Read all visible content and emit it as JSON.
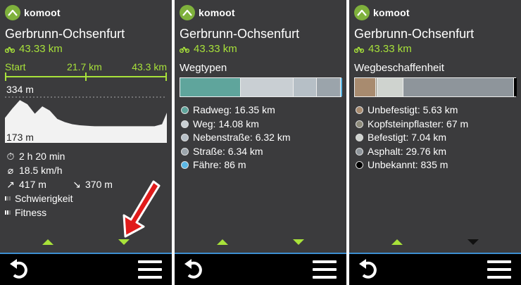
{
  "brand": "komoot",
  "route": {
    "title": "Gerbrunn-Ochsenfurt",
    "distance": "43.33 km"
  },
  "colors": {
    "accent": "#a8e23a",
    "screen_bg": "#3b3b3d",
    "bottom_bar": "#000000",
    "separator": "#3d8fd1",
    "annotation_arrow": "#e01b1b"
  },
  "screen1": {
    "scale": {
      "start": "Start",
      "mid": "21.7 km",
      "end": "43.3 km"
    },
    "elevation": {
      "max_label": "334 m",
      "min_label": "173 m"
    },
    "chart_data": {
      "type": "area",
      "x": [
        0,
        2,
        4,
        6,
        8,
        10,
        12,
        14,
        16,
        18,
        20,
        22,
        24,
        26,
        28,
        30,
        32,
        34,
        36,
        38,
        40,
        42,
        43.3
      ],
      "values": [
        235,
        280,
        320,
        300,
        255,
        290,
        270,
        230,
        215,
        205,
        200,
        197,
        195,
        195,
        195,
        195,
        195,
        195,
        195,
        195,
        195,
        205,
        260
      ],
      "ylim": [
        173,
        334
      ],
      "xlim": [
        0,
        43.3
      ]
    },
    "stats": {
      "duration": "2 h 20 min",
      "speed": "18.5 km/h",
      "ascent": "417 m",
      "descent": "370 m",
      "difficulty": "Schwierigkeit",
      "fitness": "Fitness"
    }
  },
  "screen2": {
    "section_title": "Wegtypen",
    "segments": [
      {
        "name": "Radweg",
        "label": "Radweg: 16.35 km",
        "value": 16.35,
        "color": "#5fa59c"
      },
      {
        "name": "Weg",
        "label": "Weg: 14.08 km",
        "value": 14.08,
        "color": "#c9cfd3"
      },
      {
        "name": "Nebenstraße",
        "label": "Nebenstraße: 6.32 km",
        "value": 6.32,
        "color": "#b6bfc6"
      },
      {
        "name": "Straße",
        "label": "Straße: 6.34 km",
        "value": 6.34,
        "color": "#9ba4ab"
      },
      {
        "name": "Fähre",
        "label": "Fähre: 86 m",
        "value": 0.086,
        "color": "#5bb8e6"
      }
    ]
  },
  "screen3": {
    "section_title": "Wegbeschaffenheit",
    "segments": [
      {
        "name": "Unbefestigt",
        "label": "Unbefestigt: 5.63 km",
        "value": 5.63,
        "color": "#a88b6f"
      },
      {
        "name": "Kopfsteinpflaster",
        "label": "Kopfsteinpflaster: 67 m",
        "value": 0.067,
        "color": "#8c8a7a"
      },
      {
        "name": "Befestigt",
        "label": "Befestigt: 7.04 km",
        "value": 7.04,
        "color": "#cfd3cf"
      },
      {
        "name": "Asphalt",
        "label": "Asphalt: 29.76 km",
        "value": 29.76,
        "color": "#8e959b"
      },
      {
        "name": "Unbekannt",
        "label": "Unbekannt: 835 m",
        "value": 0.835,
        "color": "#000000"
      }
    ]
  }
}
